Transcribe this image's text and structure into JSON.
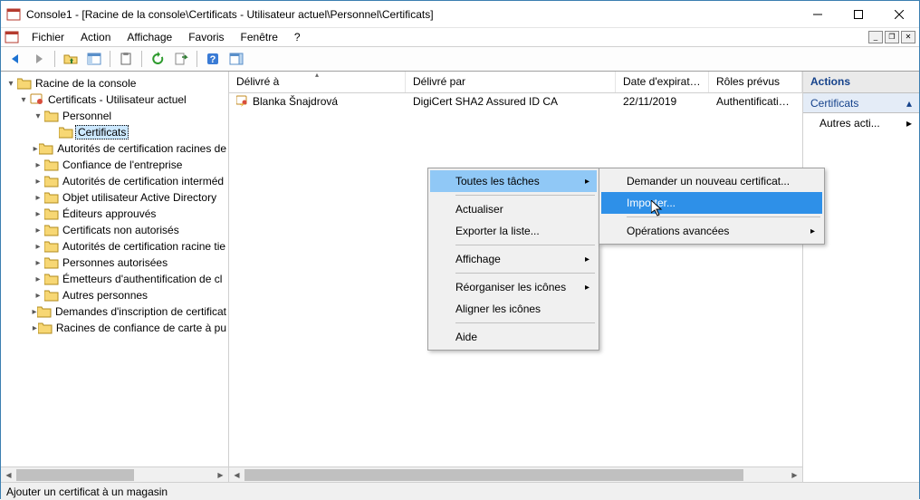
{
  "title": "Console1 - [Racine de la console\\Certificats - Utilisateur actuel\\Personnel\\Certificats]",
  "menu": {
    "fichier": "Fichier",
    "action": "Action",
    "affichage": "Affichage",
    "favoris": "Favoris",
    "fenetre": "Fenêtre",
    "aide": "?"
  },
  "tree": {
    "root": "Racine de la console",
    "certs_user": "Certificats - Utilisateur actuel",
    "personnel": "Personnel",
    "certificats": "Certificats",
    "items": [
      "Autorités de certification racines de",
      "Confiance de l'entreprise",
      "Autorités de certification interméd",
      "Objet utilisateur Active Directory",
      "Éditeurs approuvés",
      "Certificats non autorisés",
      "Autorités de certification racine tie",
      "Personnes autorisées",
      "Émetteurs d'authentification de cl",
      "Autres personnes",
      "Demandes d'inscription de certificat",
      "Racines de confiance de carte à pu"
    ]
  },
  "list": {
    "headers": {
      "issued_to": "Délivré à",
      "issued_by": "Délivré par",
      "expiry": "Date d'expirati...",
      "roles": "Rôles prévus"
    },
    "rows": [
      {
        "issued_to": "Blanka Šnajdrová",
        "issued_by": "DigiCert SHA2 Assured ID CA",
        "expiry": "22/11/2019",
        "roles": "Authentification du..."
      }
    ]
  },
  "actions": {
    "title": "Actions",
    "subtitle": "Certificats",
    "item1": "Autres acti..."
  },
  "contextmenu1": {
    "toutes": "Toutes les tâches",
    "actualiser": "Actualiser",
    "exporter": "Exporter la liste...",
    "affichage": "Affichage",
    "reorganiser": "Réorganiser les icônes",
    "aligner": "Aligner les icônes",
    "aide": "Aide"
  },
  "contextmenu2": {
    "demander": "Demander un nouveau certificat...",
    "importer": "Importer...",
    "operations": "Opérations avancées"
  },
  "status": "Ajouter un certificat à un magasin"
}
